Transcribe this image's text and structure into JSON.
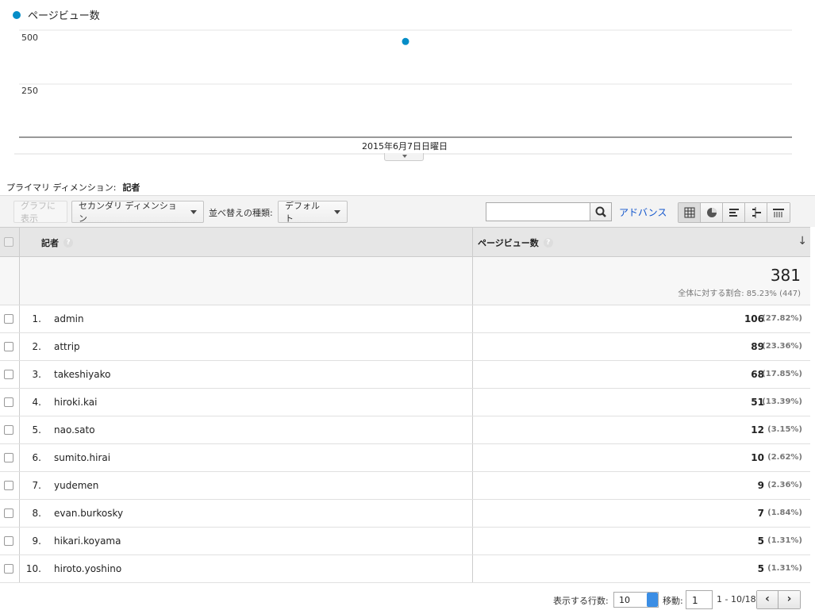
{
  "legend": {
    "label": "ページビュー数",
    "color": "#058dc7"
  },
  "chart_data": {
    "type": "scatter",
    "series": [
      {
        "name": "ページビュー数",
        "x": [
          "2015年6月7日日曜日"
        ],
        "values": [
          447
        ]
      }
    ],
    "y_ticks": [
      "500",
      "250"
    ],
    "ylim": [
      0,
      500
    ],
    "x_label_text": "2015年6月7日日曜日",
    "grid": true
  },
  "primary_dimension": {
    "label": "プライマリ ディメンション:",
    "value": "記者"
  },
  "toolbar": {
    "graph_button": "グラフに表示",
    "secondary_dimension": "セカンダリ ディメンション",
    "sort_label": "並べ替えの種類:",
    "sort_value": "デフォルト",
    "search_placeholder": "",
    "advance_link": "アドバンス"
  },
  "table": {
    "columns": [
      "記者",
      "ページビュー数"
    ],
    "help_mark": "?",
    "sort_indicator": "↓",
    "total": {
      "value": "381",
      "share": "全体に対する割合: 85.23% (447)"
    },
    "rows": [
      {
        "index": "1.",
        "name": "admin",
        "views": "106",
        "pct": "(27.82%)"
      },
      {
        "index": "2.",
        "name": "attrip",
        "views": "89",
        "pct": "(23.36%)"
      },
      {
        "index": "3.",
        "name": "takeshiyako",
        "views": "68",
        "pct": "(17.85%)"
      },
      {
        "index": "4.",
        "name": "hiroki.kai",
        "views": "51",
        "pct": "(13.39%)"
      },
      {
        "index": "5.",
        "name": "nao.sato",
        "views": "12",
        "pct": "(3.15%)"
      },
      {
        "index": "6.",
        "name": "sumito.hirai",
        "views": "10",
        "pct": "(2.62%)"
      },
      {
        "index": "7.",
        "name": "yudemen",
        "views": "9",
        "pct": "(2.36%)"
      },
      {
        "index": "8.",
        "name": "evan.burkosky",
        "views": "7",
        "pct": "(1.84%)"
      },
      {
        "index": "9.",
        "name": "hikari.koyama",
        "views": "5",
        "pct": "(1.31%)"
      },
      {
        "index": "10.",
        "name": "hiroto.yoshino",
        "views": "5",
        "pct": "(1.31%)"
      }
    ]
  },
  "footer": {
    "rows_label": "表示する行数:",
    "rows_value": "10",
    "goto_label": "移動:",
    "goto_value": "1",
    "range": "1 - 10/18",
    "prev": "‹",
    "next": "›"
  }
}
